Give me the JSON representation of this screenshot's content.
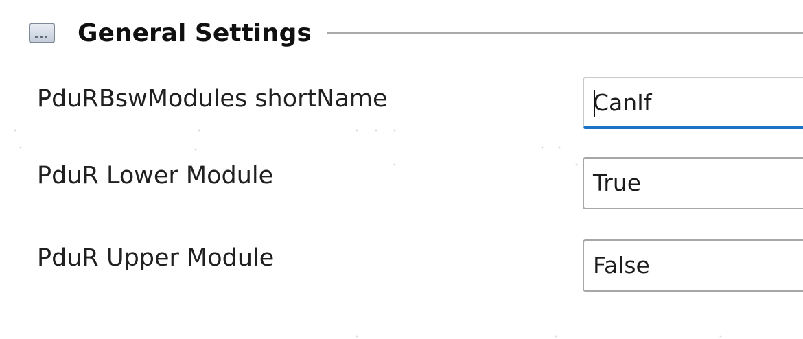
{
  "section": {
    "title": "General Settings",
    "icon": "collapse-icon"
  },
  "fields": [
    {
      "label": "PduRBswModules shortName",
      "value": "CanIf",
      "kind": "text-input"
    },
    {
      "label": "PduR Lower Module",
      "value": "True",
      "kind": "select"
    },
    {
      "label": "PduR Upper Module",
      "value": "False",
      "kind": "select"
    }
  ],
  "colors": {
    "focus_underline": "#1a73c7",
    "border": "#a7a7a7",
    "rule": "#a9a9a9"
  }
}
